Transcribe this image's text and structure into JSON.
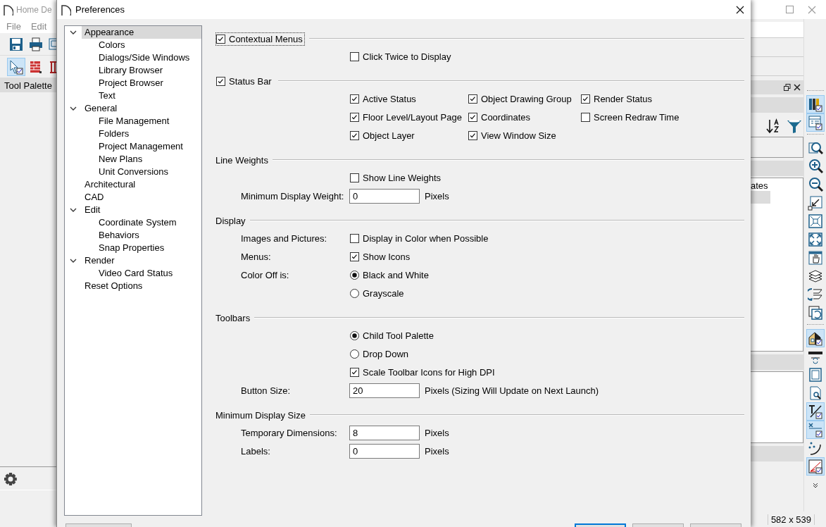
{
  "app": {
    "title": "Home De",
    "menu": [
      "File",
      "Edit"
    ],
    "tool_palette": {
      "title": "Tool Palette"
    },
    "toolbar_row_1": [
      {
        "kind": "floppy-disk",
        "pressed": false
      },
      {
        "kind": "printer",
        "pressed": false
      },
      {
        "kind": "plan",
        "pressed": false
      }
    ],
    "toolbar_row_2": [
      {
        "kind": "arrow-pointer",
        "pressed": true
      },
      {
        "kind": "wall",
        "pressed": false
      },
      {
        "kind": "railing",
        "pressed": false
      }
    ],
    "panel": {
      "list_item": "ates"
    },
    "side_toolbar": [
      [
        {
          "kind": "books",
          "pressed": true
        },
        {
          "kind": "schedule",
          "pressed": true
        }
      ],
      [
        {
          "kind": "magnifier",
          "pressed": false
        },
        {
          "kind": "zoom-in",
          "pressed": false
        },
        {
          "kind": "zoom-out",
          "pressed": false
        },
        {
          "kind": "shrink-arrow",
          "pressed": false
        },
        {
          "kind": "fill-window",
          "pressed": false
        },
        {
          "kind": "expand-arrows",
          "pressed": false
        },
        {
          "kind": "hand",
          "pressed": false
        },
        {
          "kind": "layers",
          "pressed": false
        },
        {
          "kind": "swap",
          "pressed": false
        },
        {
          "kind": "rotate",
          "pressed": false
        }
      ],
      [
        {
          "kind": "house",
          "pressed": true
        },
        {
          "kind": "bar",
          "pressed": false
        },
        {
          "kind": "frame",
          "pressed": false
        },
        {
          "kind": "page-search",
          "pressed": false
        },
        {
          "kind": "dimension",
          "pressed": true
        },
        {
          "kind": "cross-line",
          "pressed": true
        },
        {
          "kind": "arc-dots",
          "pressed": false
        },
        {
          "kind": "axes",
          "pressed": true
        }
      ]
    ],
    "status": "582 x 539"
  },
  "dialog": {
    "title": "Preferences",
    "tree": [
      {
        "label": "Appearance",
        "selected": true,
        "expanded": true,
        "children": [
          {
            "label": "Colors",
            "selected": false
          },
          {
            "label": "Dialogs/Side Windows",
            "selected": false
          },
          {
            "label": "Library Browser",
            "selected": false
          },
          {
            "label": "Project Browser",
            "selected": false
          },
          {
            "label": "Text",
            "selected": false
          }
        ]
      },
      {
        "label": "General",
        "selected": false,
        "expanded": true,
        "children": [
          {
            "label": "File Management",
            "selected": false
          },
          {
            "label": "Folders",
            "selected": false
          },
          {
            "label": "Project Management",
            "selected": false
          },
          {
            "label": "New Plans",
            "selected": false
          },
          {
            "label": "Unit Conversions",
            "selected": false
          }
        ]
      },
      {
        "label": "Architectural",
        "selected": false
      },
      {
        "label": "CAD",
        "selected": false
      },
      {
        "label": "Edit",
        "selected": false,
        "expanded": true,
        "children": [
          {
            "label": "Coordinate System",
            "selected": false
          },
          {
            "label": "Behaviors",
            "selected": false
          },
          {
            "label": "Snap Properties",
            "selected": false
          }
        ]
      },
      {
        "label": "Render",
        "selected": false,
        "expanded": true,
        "children": [
          {
            "label": "Video Card Status",
            "selected": false
          }
        ]
      },
      {
        "label": "Reset Options",
        "selected": false
      }
    ],
    "sections": [
      {
        "title": "Contextual Menus",
        "kind": "checkbox",
        "checked": true,
        "focused": true,
        "rows": [
          {
            "controls": [
              {
                "kind": "checkbox",
                "text": "Click Twice to Display",
                "checked": false
              }
            ]
          }
        ]
      },
      {
        "title": "Status Bar",
        "kind": "checkbox",
        "checked": true,
        "focused": false,
        "rows": [
          {
            "controls": [
              {
                "kind": "checkbox",
                "text": "Active Status",
                "checked": true
              },
              {
                "kind": "checkbox",
                "text": "Object Drawing Group",
                "checked": true
              },
              {
                "kind": "checkbox",
                "text": "Render Status",
                "checked": true
              }
            ]
          },
          {
            "controls": [
              {
                "kind": "checkbox",
                "text": "Floor Level/Layout Page",
                "checked": true
              },
              {
                "kind": "checkbox",
                "text": "Coordinates",
                "checked": true
              },
              {
                "kind": "checkbox",
                "text": "Screen Redraw Time",
                "checked": false
              }
            ]
          },
          {
            "controls": [
              {
                "kind": "checkbox",
                "text": "Object Layer",
                "checked": true
              },
              {
                "kind": "checkbox",
                "text": "View Window Size",
                "checked": true
              }
            ]
          }
        ]
      },
      {
        "title": "Line Weights",
        "kind": "plain",
        "rows": [
          {
            "controls": [
              {
                "kind": "checkbox",
                "text": "Show Line Weights",
                "checked": false
              }
            ]
          },
          {
            "label": "Minimum Display Weight:",
            "controls": [
              {
                "kind": "field",
                "value": "0"
              },
              {
                "kind": "unit",
                "text": "Pixels"
              }
            ]
          }
        ]
      },
      {
        "title": "Display",
        "kind": "plain",
        "rows": [
          {
            "label": "Images and Pictures:",
            "controls": [
              {
                "kind": "checkbox",
                "text": "Display in Color when Possible",
                "checked": false
              }
            ]
          },
          {
            "label": "Menus:",
            "controls": [
              {
                "kind": "checkbox",
                "text": "Show Icons",
                "checked": true
              }
            ]
          },
          {
            "label": "Color Off is:",
            "controls": [
              {
                "kind": "radio",
                "text": "Black and White",
                "selected": true
              }
            ]
          },
          {
            "controls": [
              {
                "kind": "radio",
                "text": "Grayscale",
                "selected": false
              }
            ]
          }
        ]
      },
      {
        "title": "Toolbars",
        "kind": "plain",
        "rows": [
          {
            "controls": [
              {
                "kind": "radio",
                "text": "Child Tool Palette",
                "selected": true
              }
            ]
          },
          {
            "controls": [
              {
                "kind": "radio",
                "text": "Drop Down",
                "selected": false
              }
            ]
          },
          {
            "controls": [
              {
                "kind": "checkbox",
                "text": "Scale Toolbar Icons for High DPI",
                "checked": true
              }
            ]
          },
          {
            "label": "Button Size:",
            "controls": [
              {
                "kind": "field",
                "value": "20"
              },
              {
                "kind": "unit",
                "text": "Pixels (Sizing Will Update on Next Launch)"
              }
            ]
          }
        ]
      },
      {
        "title": "Minimum Display Size",
        "kind": "plain",
        "rows": [
          {
            "label": "Temporary Dimensions:",
            "controls": [
              {
                "kind": "field",
                "value": "8"
              },
              {
                "kind": "unit",
                "text": "Pixels"
              }
            ]
          },
          {
            "label": "Labels:",
            "controls": [
              {
                "kind": "field",
                "value": "0"
              },
              {
                "kind": "unit",
                "text": "Pixels"
              }
            ]
          }
        ]
      }
    ],
    "buttons": [
      {
        "default": false
      },
      {
        "default": true
      },
      {
        "default": false
      },
      {
        "default": false
      }
    ]
  }
}
